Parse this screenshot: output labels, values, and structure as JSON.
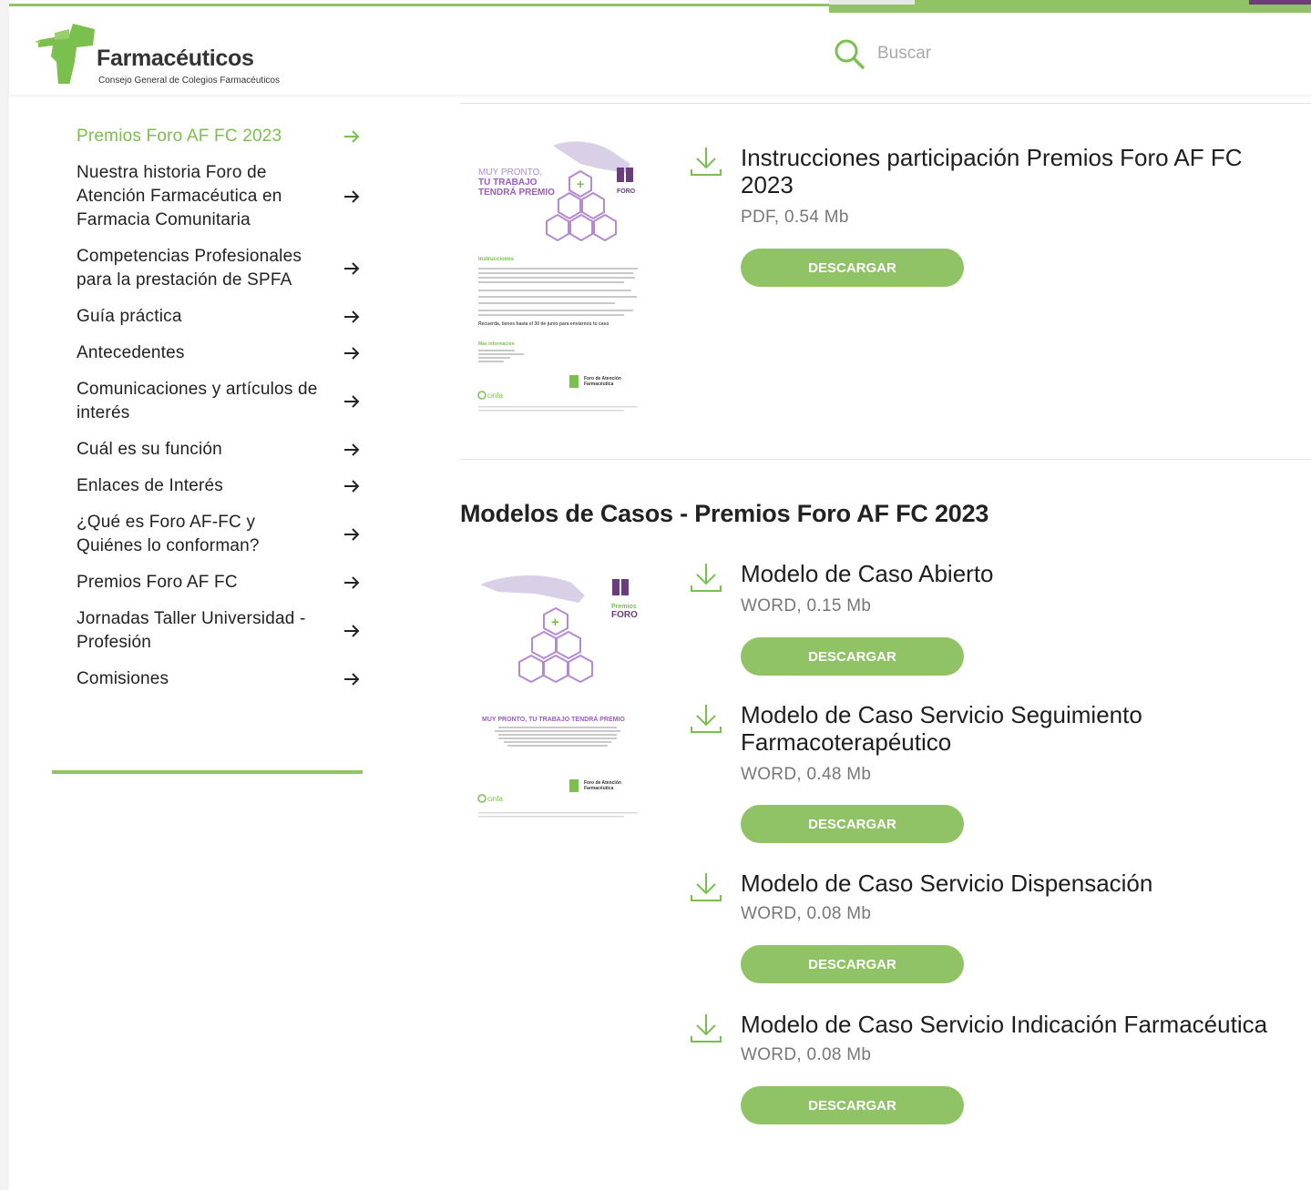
{
  "brand": {
    "name": "Farmacéuticos",
    "subtitle": "Consejo General de Colegios Farmacéuticos",
    "colors": {
      "accent": "#8fc365",
      "active_text": "#7bbf4f",
      "purple": "#6b3d7d"
    }
  },
  "search": {
    "placeholder": "Buscar",
    "icon": "search-icon"
  },
  "sidebar": {
    "items": [
      {
        "label": "Premios Foro AF FC 2023",
        "active": true
      },
      {
        "label": "Nuestra historia Foro de Atención Farmacéutica en Farmacia Comunitaria"
      },
      {
        "label": "Competencias Profesionales para la prestación de SPFA"
      },
      {
        "label": "Guía práctica"
      },
      {
        "label": "Antecedentes"
      },
      {
        "label": "Comunicaciones y artículos de interés"
      },
      {
        "label": "Cuál es su función"
      },
      {
        "label": "Enlaces de Interés"
      },
      {
        "label": "¿Qué es Foro AF-FC y Quiénes lo conforman?"
      },
      {
        "label": "Premios Foro AF FC"
      },
      {
        "label": "Jornadas Taller Universidad - Profesión"
      },
      {
        "label": "Comisiones"
      }
    ]
  },
  "instructions": {
    "title": "Instrucciones participación Premios Foro AF FC 2023",
    "meta": "PDF, 0.54 Mb",
    "button": "DESCARGAR",
    "thumb": {
      "headline_1": "MUY PRONTO,",
      "headline_2": "TU TRABAJO",
      "headline_3": "TENDRÁ PREMIO",
      "foro": "FORO",
      "section": "Instrucciones",
      "recuerda": "Recuerda, tienes hasta el 30 de junio para enviarnos tu caso",
      "mas_info": "Más información",
      "sponsor": "cinfa",
      "org_1": "Foro de Atención",
      "org_2": "Farmacéutica"
    }
  },
  "models": {
    "section_title": "Modelos de Casos - Premios Foro AF FC 2023",
    "thumb": {
      "premios": "Premios",
      "foro": "FORO",
      "headline": "MUY PRONTO, TU TRABAJO TENDRÁ PREMIO",
      "sponsor": "cinfa",
      "org_1": "Foro de Atención",
      "org_2": "Farmacéutica"
    },
    "items": [
      {
        "title": "Modelo de Caso Abierto",
        "meta": "WORD, 0.15 Mb",
        "button": "DESCARGAR"
      },
      {
        "title": "Modelo de Caso Servicio Seguimiento Farmacoterapéutico",
        "meta": "WORD, 0.48 Mb",
        "button": "DESCARGAR"
      },
      {
        "title": "Modelo de Caso Servicio Dispensación",
        "meta": "WORD, 0.08 Mb",
        "button": "DESCARGAR"
      },
      {
        "title": "Modelo de Caso Servicio Indicación Farmacéutica",
        "meta": "WORD, 0.08 Mb",
        "button": "DESCARGAR"
      }
    ]
  }
}
